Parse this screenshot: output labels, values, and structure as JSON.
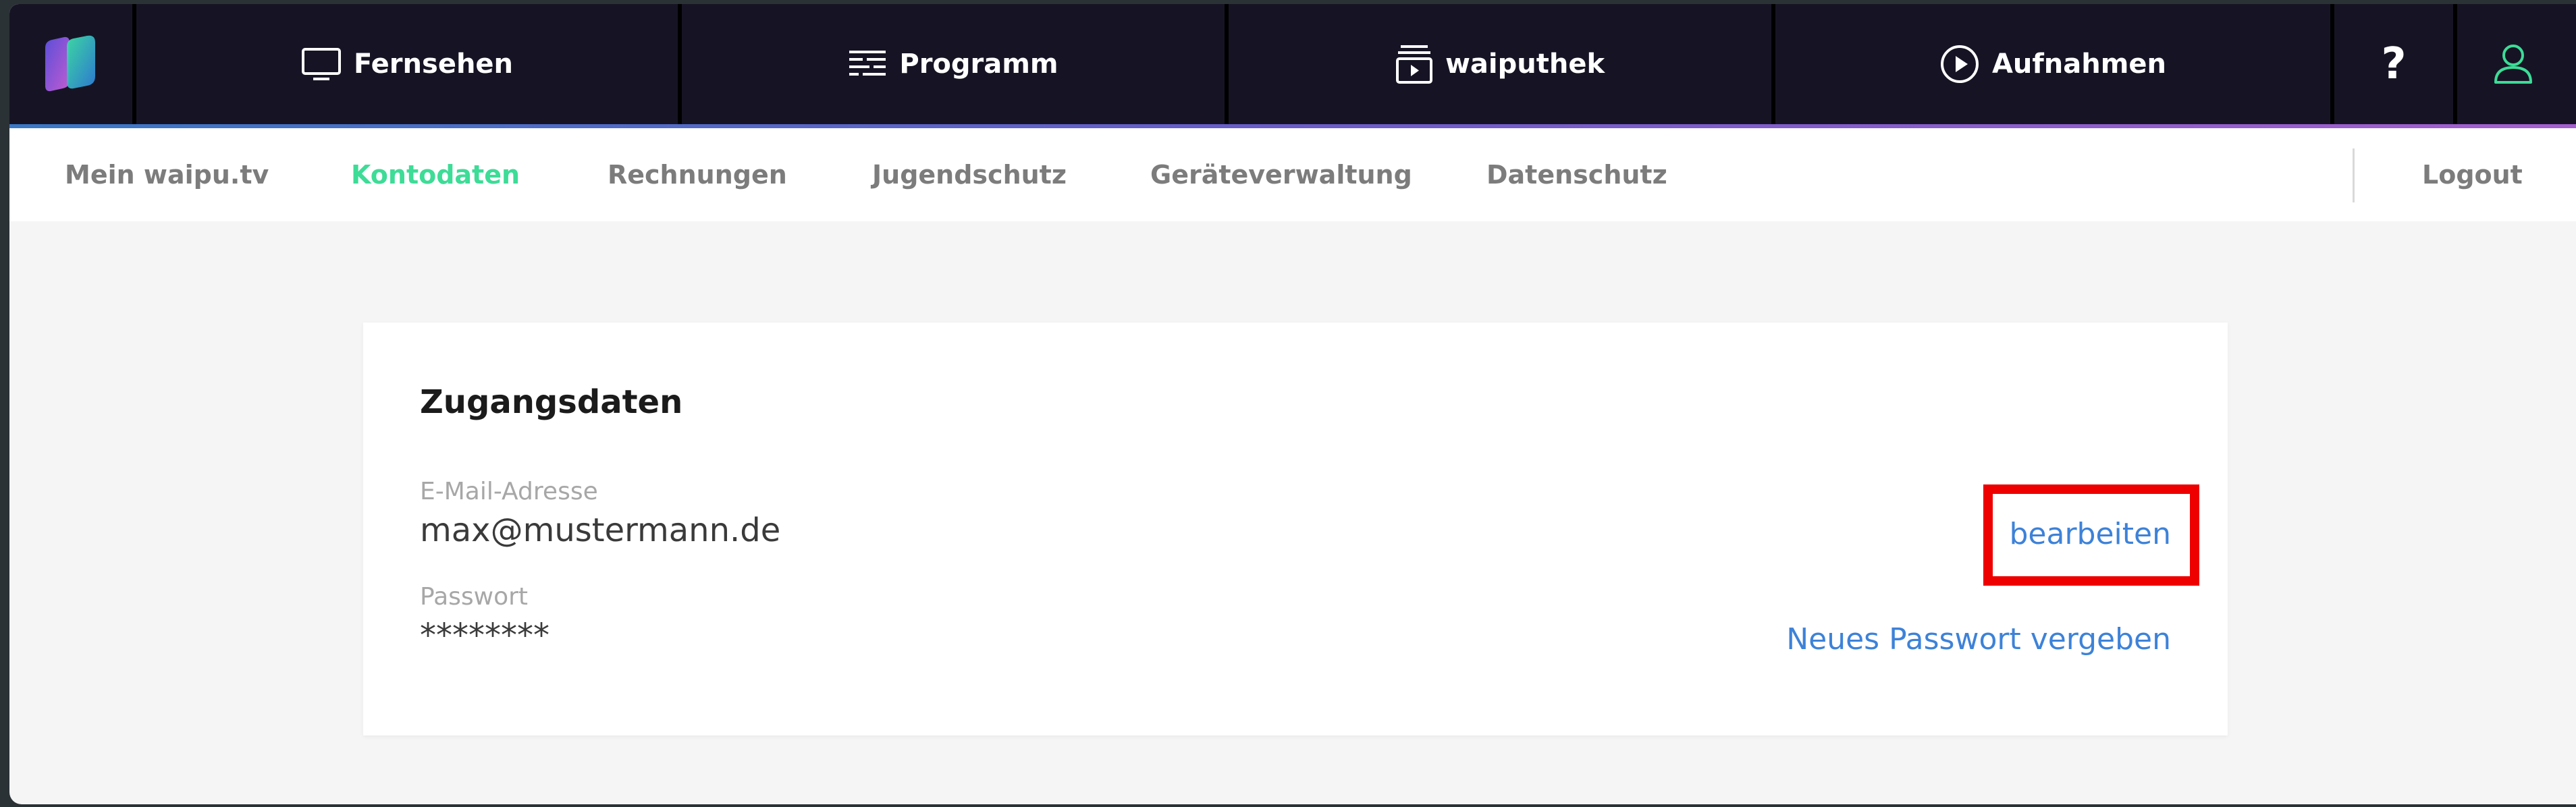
{
  "topnav": {
    "tabs": [
      {
        "label": "Fernsehen",
        "icon": "tv-icon"
      },
      {
        "label": "Programm",
        "icon": "program-guide-icon"
      },
      {
        "label": "waiputhek",
        "icon": "library-play-icon"
      },
      {
        "label": "Aufnahmen",
        "icon": "play-circle-icon"
      }
    ],
    "help_label": "?",
    "user_icon": "user-icon"
  },
  "subnav": {
    "items": [
      {
        "label": "Mein waipu.tv"
      },
      {
        "label": "Kontodaten"
      },
      {
        "label": "Rechnungen"
      },
      {
        "label": "Jugendschutz"
      },
      {
        "label": "Geräteverwaltung"
      },
      {
        "label": "Datenschutz"
      }
    ],
    "active": "Kontodaten",
    "logout": "Logout"
  },
  "card": {
    "title": "Zugangsdaten",
    "email_label": "E-Mail-Adresse",
    "email_value": "max@mustermann.de",
    "password_label": "Passwort",
    "password_value": "********",
    "edit_link": "bearbeiten",
    "new_password_link": "Neues Passwort vergeben"
  },
  "colors": {
    "nav_bg": "#161424",
    "accent": "#3ddc97",
    "link": "#3d82d8",
    "highlight": "#ee0000"
  }
}
